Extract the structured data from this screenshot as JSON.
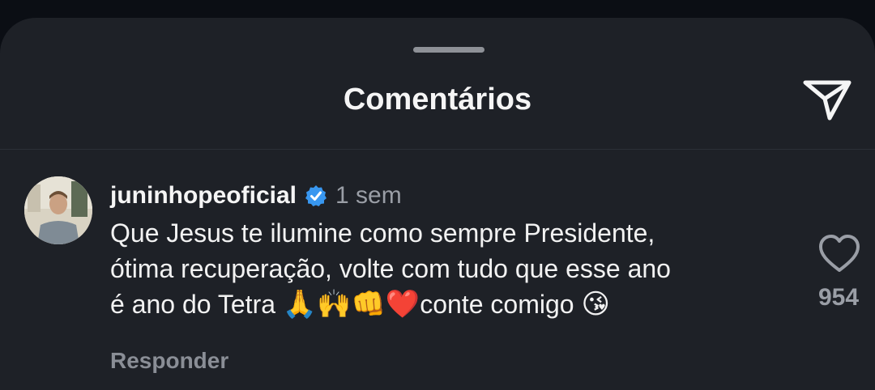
{
  "sheet": {
    "title": "Comentários"
  },
  "comment": {
    "username": "juninhopeoficial",
    "time_ago": "1 sem",
    "lines": [
      "Que Jesus te ilumine como sempre Presidente,",
      "ótima recuperação, volte com tudo que esse ano",
      "é ano do Tetra "
    ],
    "emojis": "🙏🙌👊❤️",
    "tail_text": "conte comigo ",
    "tail_emoji": "😘",
    "reply_label": "Responder",
    "like_count": "954"
  },
  "colors": {
    "background": "#0b0e14",
    "sheet": "#1e2127",
    "verified_badge": "#3897f0",
    "muted_text": "#9a9ea6"
  },
  "icons": {
    "share": "paper-plane-icon",
    "like": "heart-outline-icon",
    "verified": "verified-badge-icon"
  }
}
